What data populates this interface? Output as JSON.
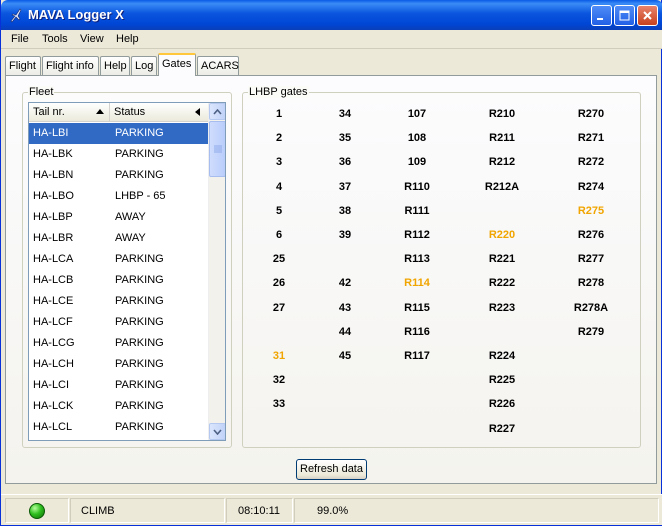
{
  "window": {
    "title": "MAVA Logger X",
    "accent": "#0a55de"
  },
  "menu": [
    "File",
    "Tools",
    "View",
    "Help"
  ],
  "tabs": [
    "Flight",
    "Flight info",
    "Help",
    "Log",
    "Gates",
    "ACARS"
  ],
  "active_tab": "Gates",
  "fleet": {
    "label": "Fleet",
    "columns": {
      "tail": "Tail nr.",
      "status": "Status"
    },
    "rows": [
      {
        "tail": "HA-LBI",
        "status": "PARKING"
      },
      {
        "tail": "HA-LBK",
        "status": "PARKING"
      },
      {
        "tail": "HA-LBN",
        "status": "PARKING"
      },
      {
        "tail": "HA-LBO",
        "status": "LHBP - 65"
      },
      {
        "tail": "HA-LBP",
        "status": "AWAY"
      },
      {
        "tail": "HA-LBR",
        "status": "AWAY"
      },
      {
        "tail": "HA-LCA",
        "status": "PARKING"
      },
      {
        "tail": "HA-LCB",
        "status": "PARKING"
      },
      {
        "tail": "HA-LCE",
        "status": "PARKING"
      },
      {
        "tail": "HA-LCF",
        "status": "PARKING"
      },
      {
        "tail": "HA-LCG",
        "status": "PARKING"
      },
      {
        "tail": "HA-LCH",
        "status": "PARKING"
      },
      {
        "tail": "HA-LCI",
        "status": "PARKING"
      },
      {
        "tail": "HA-LCK",
        "status": "PARKING"
      },
      {
        "tail": "HA-LCL",
        "status": "PARKING"
      }
    ],
    "selected_index": 0
  },
  "gates": {
    "label": "LHBP gates",
    "occupied_color": "#f0a500",
    "columns": [
      [
        "1",
        "2",
        "3",
        "4",
        "5",
        "6",
        "25",
        "26",
        "27",
        "",
        "31",
        "32",
        "33"
      ],
      [
        "34",
        "35",
        "36",
        "37",
        "38",
        "39",
        "",
        "42",
        "43",
        "44",
        "45"
      ],
      [
        "107",
        "108",
        "109",
        "R110",
        "R111",
        "R112",
        "R113",
        "R114",
        "R115",
        "R116",
        "R117"
      ],
      [
        "R210",
        "R211",
        "R212",
        "R212A",
        "",
        "R220",
        "R221",
        "R222",
        "R223",
        "",
        "R224",
        "R225",
        "R226",
        "R227"
      ],
      [
        "R270",
        "R271",
        "R272",
        "R274",
        "R275",
        "R276",
        "R277",
        "R278",
        "R278A",
        "R279"
      ]
    ],
    "occupied": [
      "31",
      "R114",
      "R220",
      "R275"
    ]
  },
  "refresh_button": "Refresh data",
  "status": {
    "phase": "CLIMB",
    "time": "08:10:11",
    "percent": "99.0%"
  }
}
